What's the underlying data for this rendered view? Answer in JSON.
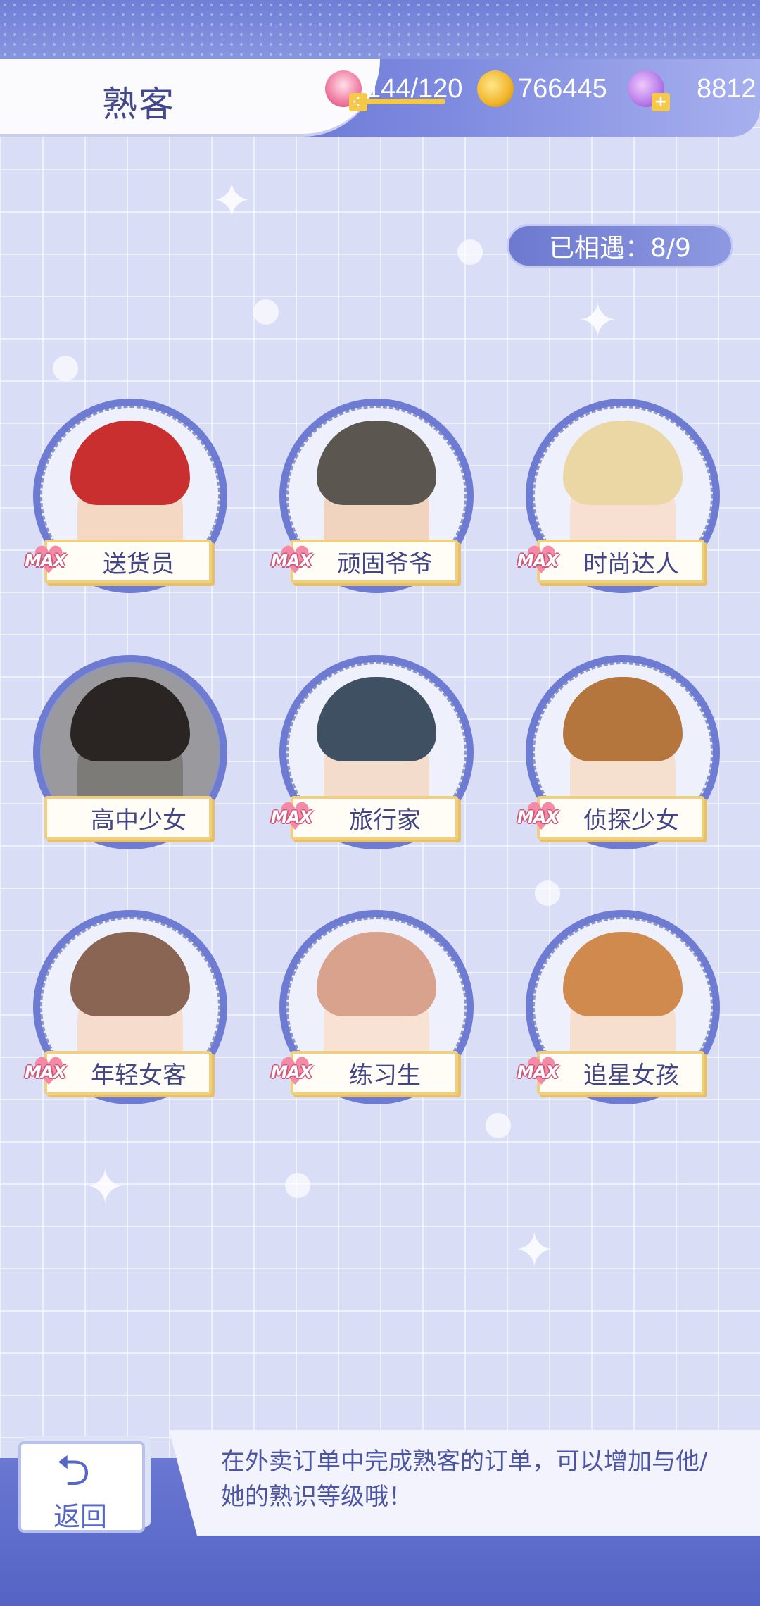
{
  "header": {
    "title": "熟客",
    "stamina": "144/120",
    "coins": "766445",
    "swans": "8812"
  },
  "met_counter": "已相遇：8/9",
  "customers": [
    {
      "name": "送货员",
      "max": "MAX"
    },
    {
      "name": "顽固爷爷",
      "max": "MAX"
    },
    {
      "name": "时尚达人",
      "max": "MAX"
    },
    {
      "name": "高中少女",
      "max": ""
    },
    {
      "name": "旅行家",
      "max": "MAX"
    },
    {
      "name": "侦探少女",
      "max": "MAX"
    },
    {
      "name": "年轻女客",
      "max": "MAX"
    },
    {
      "name": "练习生",
      "max": "MAX"
    },
    {
      "name": "追星女孩",
      "max": "MAX"
    }
  ],
  "hint": "在外卖订单中完成熟客的订单，可以增加与他/她的熟识等级哦！",
  "back_label": "返回",
  "icons": {
    "stamina": "cake-icon",
    "coins": "coin-icon",
    "swans": "swan-icon",
    "back": "back-arrow-icon"
  },
  "colors": {
    "accent": "#6e7bd3",
    "plate_border": "#f0cf7e",
    "max_heart": "#f48aa6"
  }
}
